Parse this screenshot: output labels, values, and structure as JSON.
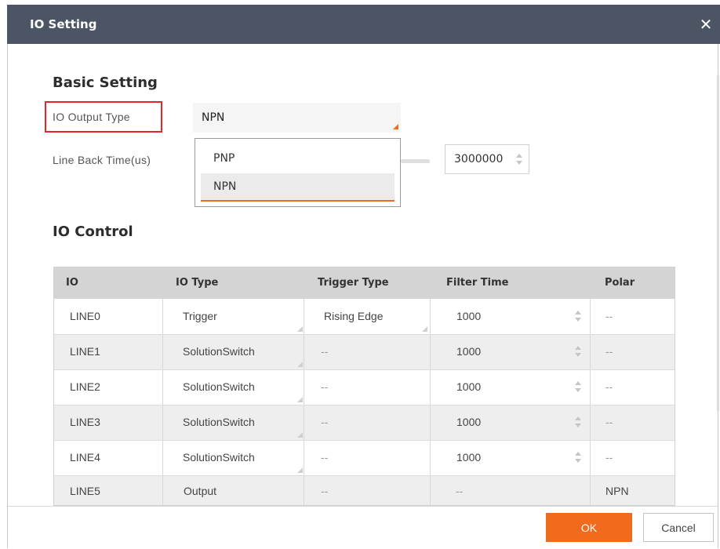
{
  "dialog": {
    "title": "IO Setting",
    "close_glyph": "✕"
  },
  "basic": {
    "heading": "Basic Setting",
    "output_type_label": "IO Output Type",
    "output_type_value": "NPN",
    "output_options": [
      "PNP",
      "NPN"
    ],
    "output_selected": "NPN",
    "line_back_label": "Line Back Time(us)",
    "line_back_value": "3000000"
  },
  "control": {
    "heading": "IO Control",
    "columns": [
      "IO",
      "IO Type",
      "Trigger Type",
      "Filter Time",
      "Polar"
    ],
    "rows": [
      {
        "io": "LINE0",
        "type": "Trigger",
        "trigger": "Rising Edge",
        "filter": "1000",
        "polar": "--"
      },
      {
        "io": "LINE1",
        "type": "SolutionSwitch",
        "trigger": "--",
        "filter": "1000",
        "polar": "--"
      },
      {
        "io": "LINE2",
        "type": "SolutionSwitch",
        "trigger": "--",
        "filter": "1000",
        "polar": "--"
      },
      {
        "io": "LINE3",
        "type": "SolutionSwitch",
        "trigger": "--",
        "filter": "1000",
        "polar": "--"
      },
      {
        "io": "LINE4",
        "type": "SolutionSwitch",
        "trigger": "--",
        "filter": "1000",
        "polar": "--"
      },
      {
        "io": "LINE5",
        "type": "Output",
        "trigger": "--",
        "filter": "--",
        "polar": "NPN"
      }
    ]
  },
  "footer": {
    "ok_label": "OK",
    "cancel_label": "Cancel"
  },
  "colors": {
    "accent": "#f26b1d",
    "title_bar": "#4b5563",
    "highlight": "#e32626"
  }
}
